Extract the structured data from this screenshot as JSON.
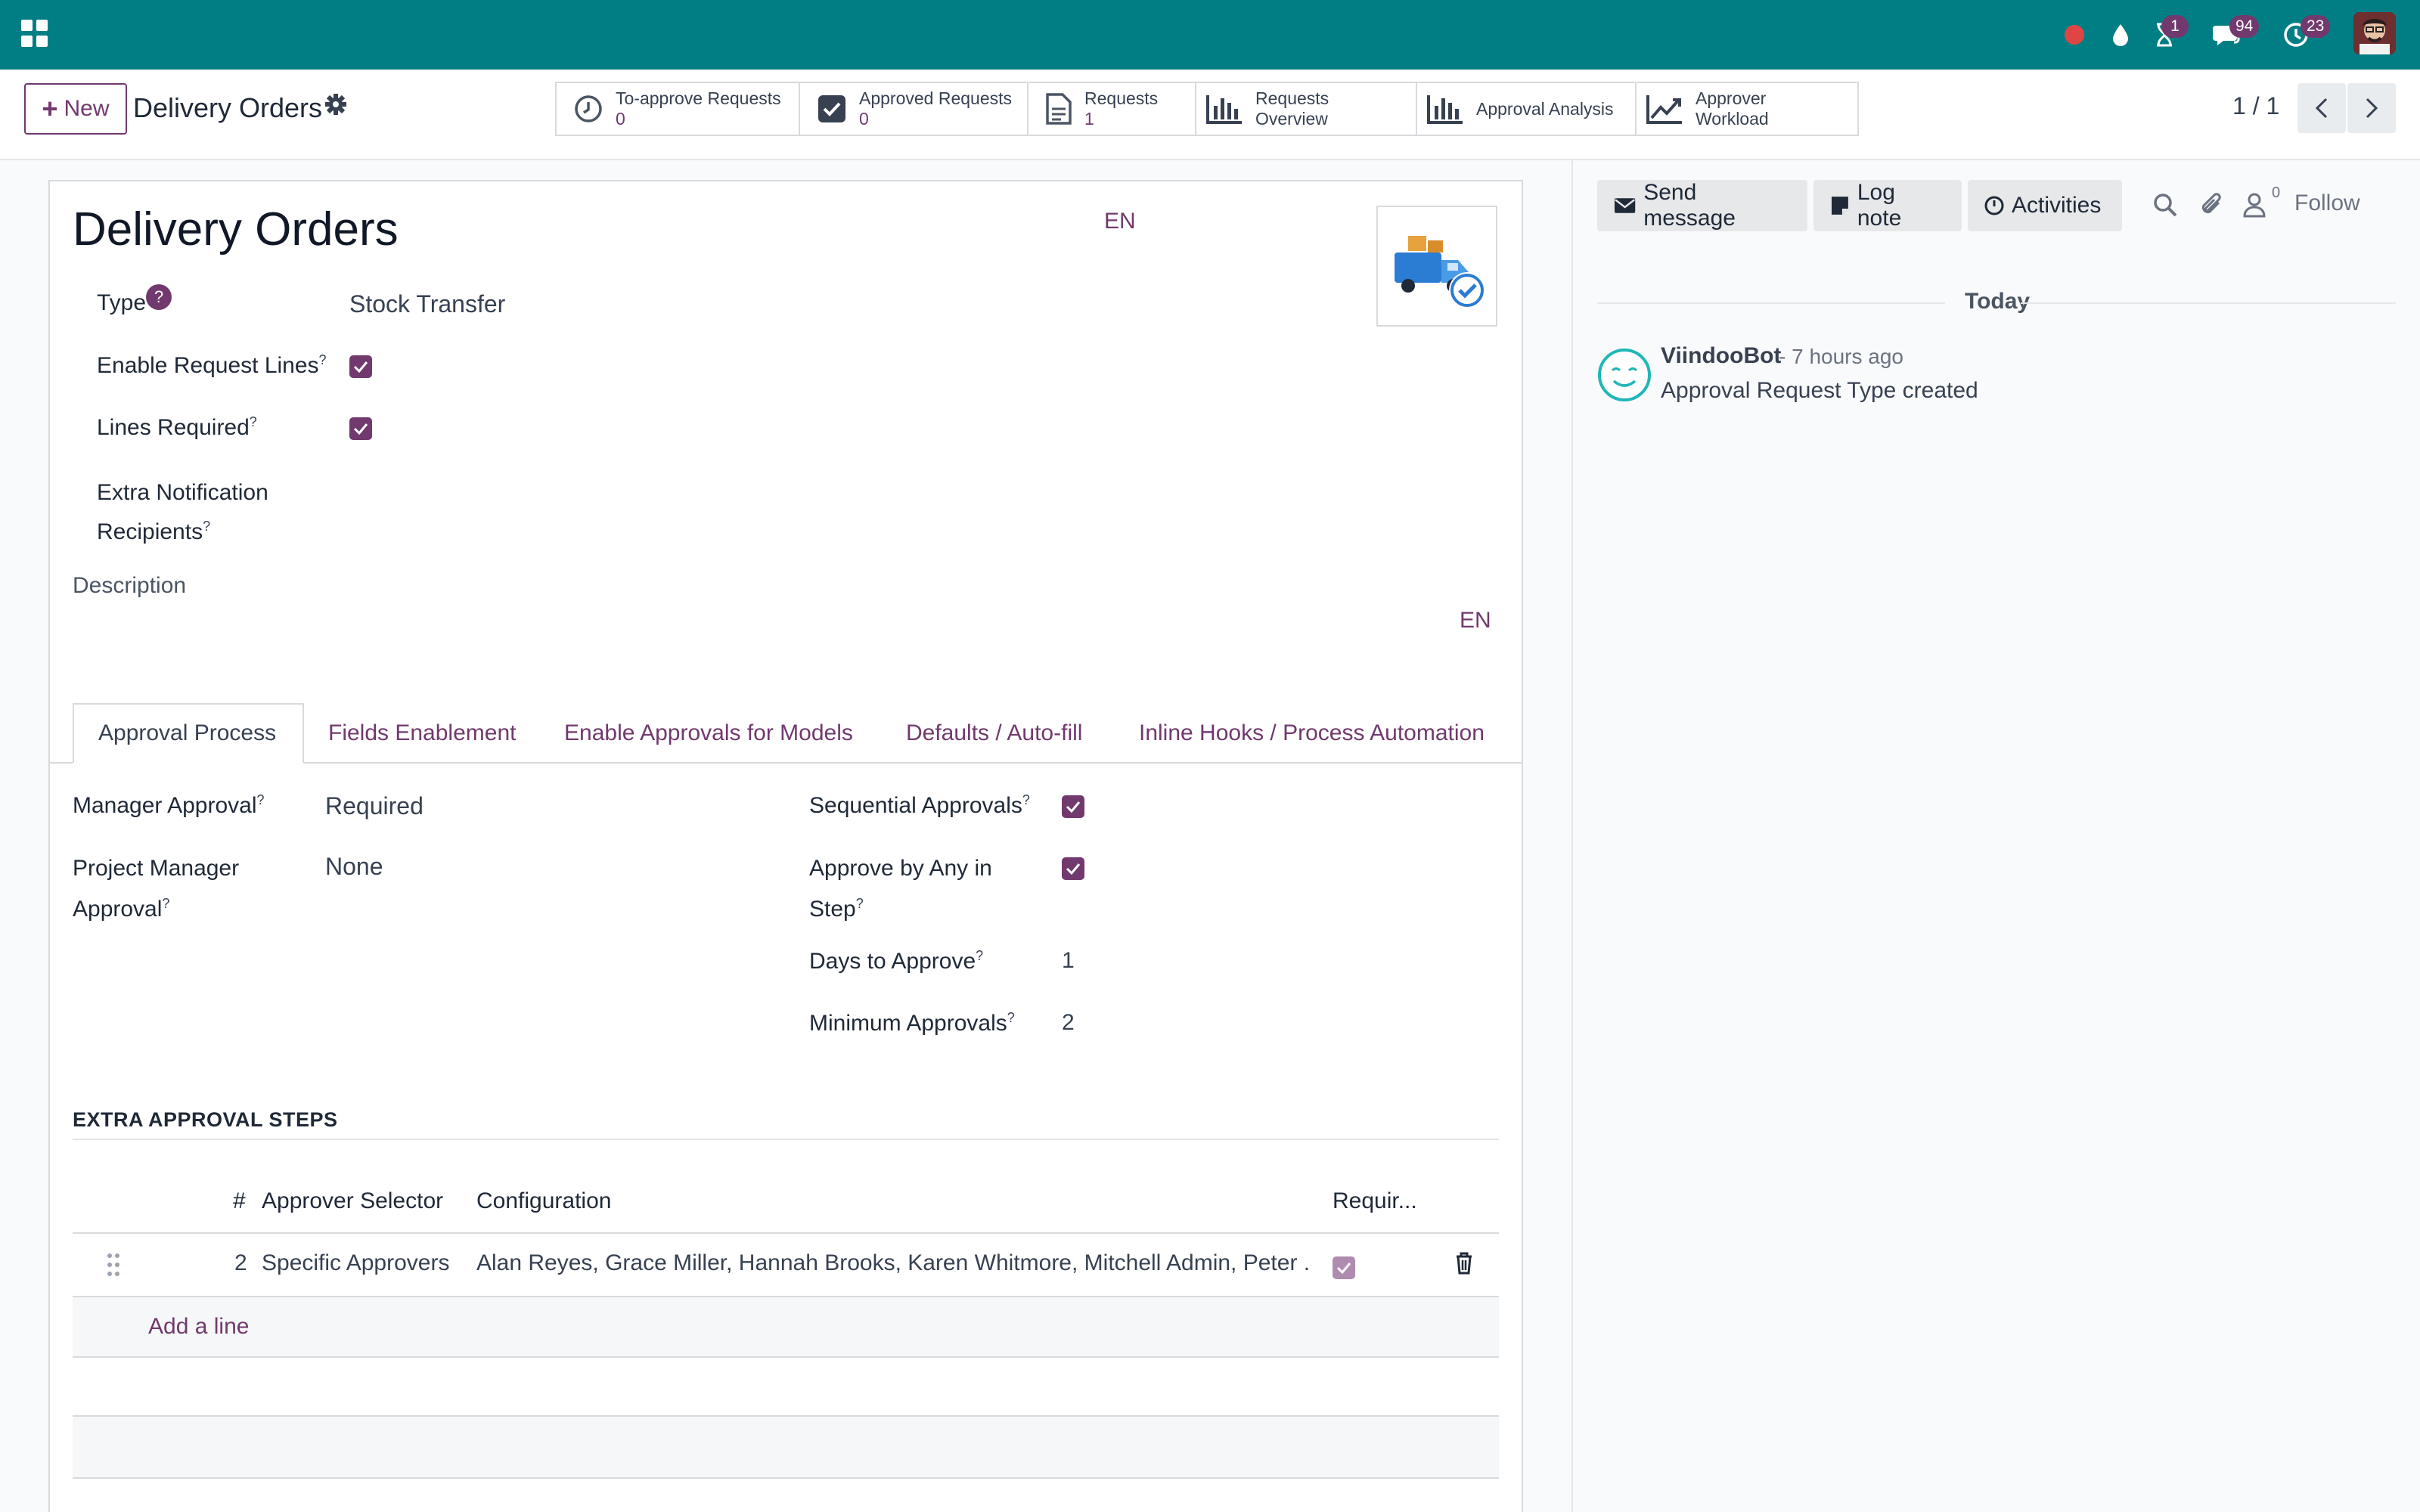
{
  "navbar": {
    "apps_icon": "apps-grid-icon",
    "icons": [
      "record-dot-icon",
      "water-drop-icon",
      "hourglass-icon",
      "chat-bubble-icon",
      "clock-activity-icon"
    ],
    "badges": {
      "hourglass": "1",
      "messages": "94",
      "activities": "23"
    },
    "brand_color": "#017e84"
  },
  "control_panel": {
    "new_label": "New",
    "breadcrumb": "Delivery Orders",
    "smart_buttons": [
      {
        "label": "To-approve Requests",
        "value": "0",
        "icon": "clock-icon"
      },
      {
        "label": "Approved Requests",
        "value": "0",
        "icon": "checkbox-icon"
      },
      {
        "label": "Requests",
        "value": "1",
        "icon": "document-icon"
      },
      {
        "label": "Requests Overview",
        "icon": "bar-chart-icon"
      },
      {
        "label": "Approval Analysis",
        "icon": "bar-chart-icon"
      },
      {
        "label": "Approver Workload",
        "icon": "line-chart-icon"
      }
    ],
    "pager": "1 / 1"
  },
  "form": {
    "title": "Delivery Orders",
    "title_lang": "EN",
    "fields": {
      "type": {
        "label": "Type",
        "help": "?",
        "value": "Stock Transfer"
      },
      "enable_request_lines": {
        "label": "Enable Request Lines",
        "checked": true
      },
      "lines_required": {
        "label": "Lines Required",
        "checked": true
      },
      "extra_notification_line1": "Extra Notification",
      "extra_notification_line2": "Recipients"
    },
    "description_label": "Description",
    "description_lang": "EN",
    "tabs": [
      "Approval Process",
      "Fields Enablement",
      "Enable Approvals for Models",
      "Defaults / Auto-fill",
      "Inline Hooks / Process Automation"
    ],
    "approval": {
      "manager_approval_label": "Manager Approval",
      "manager_approval_value": "Required",
      "project_manager_line1": "Project Manager",
      "project_manager_line2": "Approval",
      "project_manager_value": "None",
      "sequential_label": "Sequential Approvals",
      "approve_any_line1": "Approve by Any in",
      "approve_any_line2": "Step",
      "days_label": "Days to Approve",
      "days_value": "1",
      "min_label": "Minimum Approvals",
      "min_value": "2"
    },
    "steps": {
      "title": "EXTRA APPROVAL STEPS",
      "columns": [
        "#",
        "Approver Selector",
        "Configuration",
        "Requir..."
      ],
      "rows": [
        {
          "num": "2",
          "selector": "Specific Approvers",
          "configuration": "Alan Reyes, Grace Miller, Hannah Brooks, Karen Whitmore, Mitchell Admin, Peter ...",
          "required": true
        }
      ],
      "add_line": "Add a line"
    }
  },
  "chatter": {
    "send_message": "Send message",
    "log_note": "Log note",
    "activities": "Activities",
    "follower_count": "0",
    "follow": "Follow",
    "date_separator": "Today",
    "messages": [
      {
        "author": "ViindooBot",
        "time": "- 7 hours ago",
        "body": "Approval Request Type created"
      }
    ]
  }
}
